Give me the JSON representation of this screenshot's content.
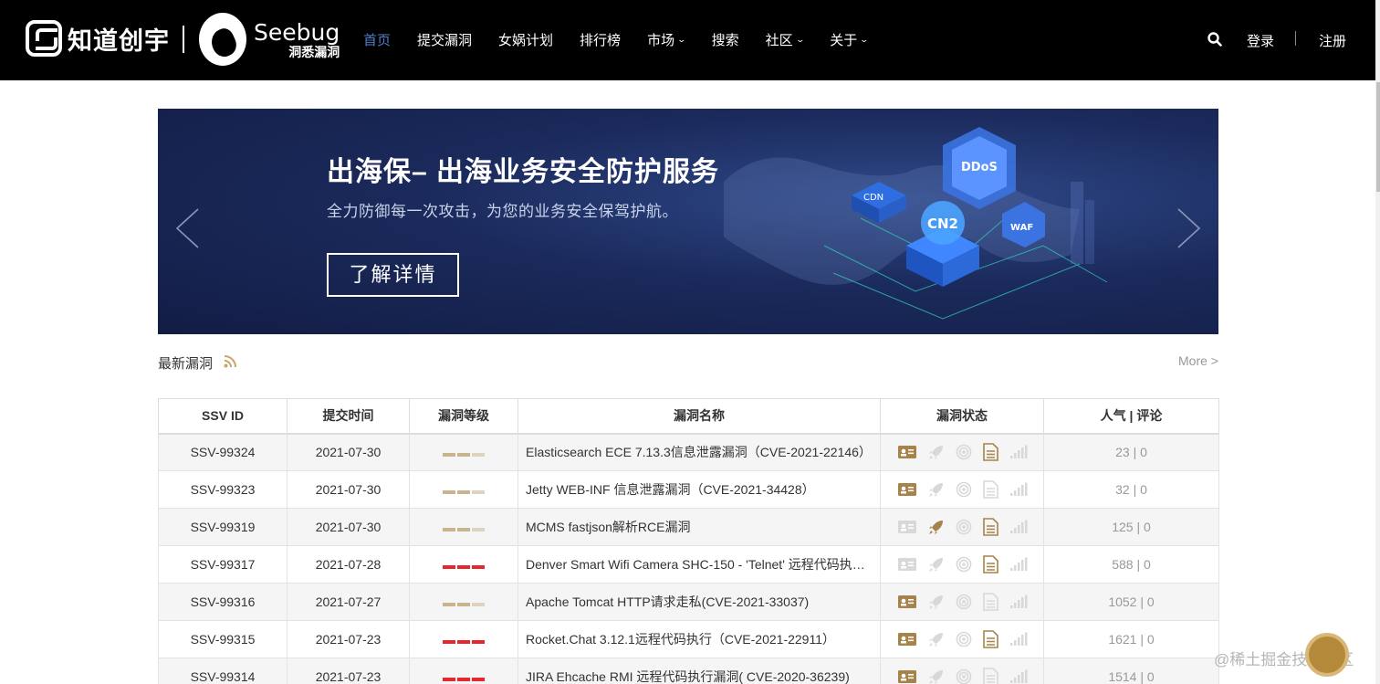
{
  "header": {
    "brand_text": "知道创宇",
    "seebug_title": "Seebug",
    "seebug_sub": "洞悉漏洞",
    "nav": [
      {
        "label": "首页",
        "active": true,
        "dropdown": false
      },
      {
        "label": "提交漏洞",
        "active": false,
        "dropdown": false
      },
      {
        "label": "女娲计划",
        "active": false,
        "dropdown": false
      },
      {
        "label": "排行榜",
        "active": false,
        "dropdown": false
      },
      {
        "label": "市场",
        "active": false,
        "dropdown": true
      },
      {
        "label": "搜索",
        "active": false,
        "dropdown": false
      },
      {
        "label": "社区",
        "active": false,
        "dropdown": true
      },
      {
        "label": "关于",
        "active": false,
        "dropdown": true
      }
    ],
    "login": "登录",
    "register": "注册"
  },
  "banner": {
    "title": "出海保– 出海业务安全防护服务",
    "subtitle": "全力防御每一次攻击，为您的业务安全保驾护航。",
    "button": "了解详情",
    "badges": [
      "DDoS",
      "CDN",
      "CN2",
      "WAF"
    ]
  },
  "section": {
    "title": "最新漏洞",
    "more": "More >"
  },
  "table": {
    "headers": [
      "SSV ID",
      "提交时间",
      "漏洞等级",
      "漏洞名称",
      "漏洞状态",
      "人气 | 评论"
    ],
    "rows": [
      {
        "id": "SSV-99324",
        "date": "2021-07-30",
        "level": "medium",
        "name": "Elasticsearch ECE 7.13.3信息泄露漏洞（CVE-2021-22146）",
        "status": [
          true,
          false,
          false,
          true,
          false
        ],
        "pop": "23 | 0"
      },
      {
        "id": "SSV-99323",
        "date": "2021-07-30",
        "level": "medium",
        "name": "Jetty WEB-INF 信息泄露漏洞（CVE-2021-34428）",
        "status": [
          true,
          false,
          false,
          false,
          false
        ],
        "pop": "32 | 0"
      },
      {
        "id": "SSV-99319",
        "date": "2021-07-30",
        "level": "medium",
        "name": "MCMS fastjson解析RCE漏洞",
        "status": [
          false,
          true,
          false,
          true,
          false
        ],
        "pop": "125 | 0"
      },
      {
        "id": "SSV-99317",
        "date": "2021-07-28",
        "level": "high",
        "name": "Denver Smart Wifi Camera SHC-150 - 'Telnet' 远程代码执…",
        "status": [
          false,
          false,
          false,
          true,
          false
        ],
        "pop": "588 | 0"
      },
      {
        "id": "SSV-99316",
        "date": "2021-07-27",
        "level": "medium",
        "name": "Apache Tomcat HTTP请求走私(CVE-2021-33037)",
        "status": [
          true,
          false,
          false,
          false,
          false
        ],
        "pop": "1052 | 0"
      },
      {
        "id": "SSV-99315",
        "date": "2021-07-23",
        "level": "high",
        "name": "Rocket.Chat 3.12.1远程代码执行（CVE-2021-22911）",
        "status": [
          true,
          false,
          false,
          true,
          false
        ],
        "pop": "1621 | 0"
      },
      {
        "id": "SSV-99314",
        "date": "2021-07-23",
        "level": "high",
        "name": "JIRA Ehcache RMI 远程代码执行漏洞( CVE-2020-36239)",
        "status": [
          true,
          false,
          false,
          false,
          false
        ],
        "pop": "1514 | 0"
      }
    ]
  },
  "colors": {
    "nav_active": "#4f7fc9",
    "level_medium": "#c8b590",
    "level_high": "#e8262c",
    "icon_active": "#a6834a",
    "icon_inactive": "#d8d8d8"
  },
  "watermark": "@稀土掘金技术社区"
}
